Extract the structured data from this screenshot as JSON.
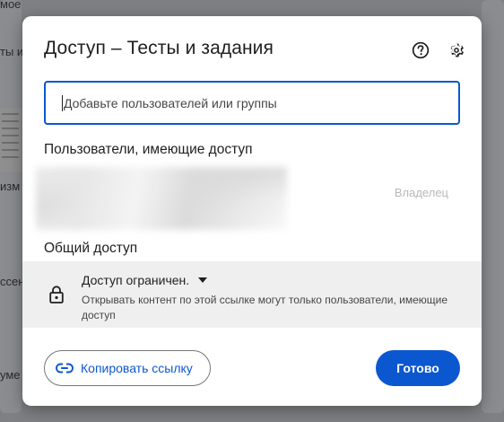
{
  "background": {
    "fragments": [
      "мое",
      "ты и",
      "изм",
      "ссен",
      "уме"
    ]
  },
  "dialog": {
    "title": "Доступ – Тесты и задания",
    "help_icon": "help-circle-icon",
    "settings_icon": "gear-icon",
    "search": {
      "placeholder": "Добавьте пользователей или группы",
      "value": ""
    },
    "users_section": {
      "label": "Пользователи, имеющие доступ",
      "owner_role": "Владелец"
    },
    "general_section": {
      "label": "Общий доступ",
      "selected_option": "Доступ ограничен.",
      "description": "Открывать контент по этой ссылке могут только пользователи, имеющие доступ"
    },
    "copy_link_label": "Копировать ссылку",
    "done_label": "Готово"
  },
  "colors": {
    "accent": "#0b57d0",
    "overlay": "#7e8083",
    "general_box": "#efeff0"
  }
}
